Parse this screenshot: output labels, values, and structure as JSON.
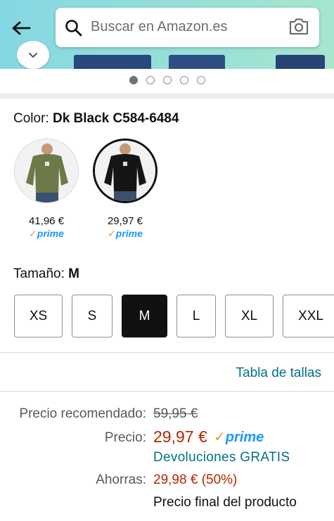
{
  "header": {
    "search_placeholder": "Buscar en Amazon.es"
  },
  "carousel": {
    "dots": 5,
    "active_index": 0
  },
  "color_selection": {
    "label": "Color:",
    "selected": "Dk Black C584-6484",
    "options": [
      {
        "price": "41,96 €",
        "prime_check": "✓",
        "prime_word": "prime",
        "shirt_color": "#6c7a4a"
      },
      {
        "price": "29,97 €",
        "prime_check": "✓",
        "prime_word": "prime",
        "shirt_color": "#151515"
      }
    ]
  },
  "size_selection": {
    "label": "Tamaño:",
    "selected": "M",
    "sizes": [
      "XS",
      "S",
      "M",
      "L",
      "XL",
      "XXL"
    ]
  },
  "size_chart_link": "Tabla de tallas",
  "pricing": {
    "recommended_label": "Precio recomendado:",
    "recommended_value": "59,95 €",
    "price_label": "Precio:",
    "price_value": "29,97 €",
    "prime_check": "✓",
    "prime_word": "prime",
    "returns": "Devoluciones GRATIS",
    "savings_label": "Ahorras:",
    "savings_value": "29,98 € (50%)",
    "final_price_note": "Precio final del producto"
  },
  "colors": {
    "price_red": "#b12704",
    "link_teal": "#007185",
    "prime_blue": "#1a98ff",
    "prime_orange": "#f29a1f",
    "header_gradient_start": "#84d8e3",
    "header_gradient_end": "#a6e6ce"
  }
}
